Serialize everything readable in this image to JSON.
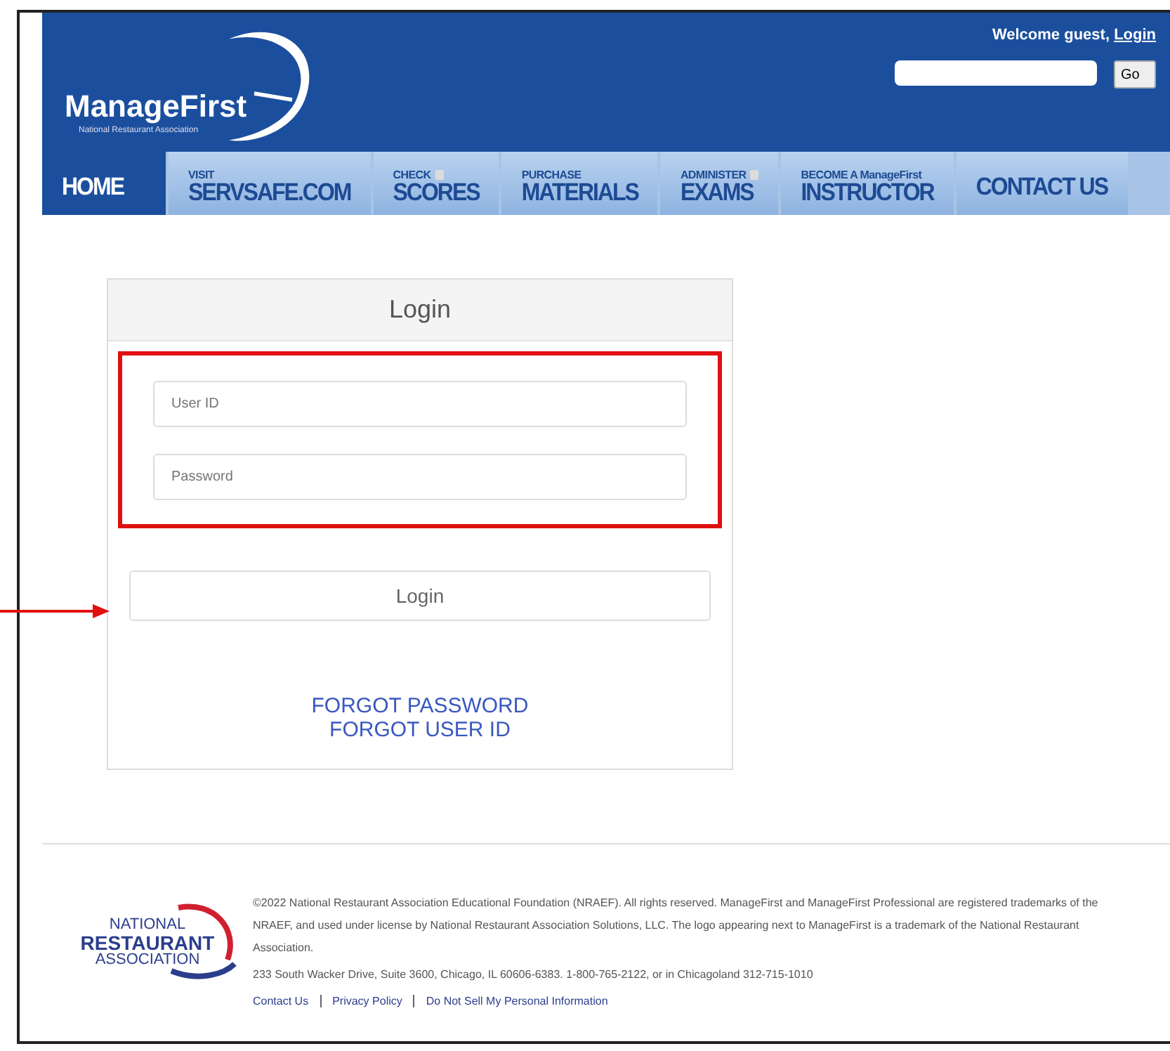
{
  "header": {
    "logo": {
      "name": "ManageFirst",
      "tagline": "National Restaurant Association"
    },
    "welcome": "Welcome guest,",
    "login_link": "Login",
    "search": {
      "button": "Go"
    }
  },
  "nav": [
    {
      "main": "HOME",
      "lock": false,
      "selected": true
    },
    {
      "top": "VISIT",
      "main": "SERVSAFE.COM",
      "lock": false,
      "selected": false
    },
    {
      "top": "CHECK",
      "main": "SCORES",
      "lock": true,
      "selected": false
    },
    {
      "top": "PURCHASE",
      "main": "MATERIALS",
      "lock": false,
      "selected": false
    },
    {
      "top": "ADMINISTER",
      "main": "EXAMS",
      "lock": true,
      "selected": false
    },
    {
      "top": "BECOME A ManageFirst",
      "main": "INSTRUCTOR",
      "lock": false,
      "selected": false
    },
    {
      "main": "CONTACT US",
      "lock": false,
      "selected": false
    }
  ],
  "login": {
    "title": "Login",
    "fields": [
      {
        "placeholder": "User ID"
      },
      {
        "placeholder": "Password"
      }
    ],
    "button": "Login",
    "links": [
      "FORGOT PASSWORD",
      "FORGOT USER ID"
    ]
  },
  "footer": {
    "logo": {
      "top": "NATIONAL",
      "middle": "RESTAURANT",
      "bottom": "ASSOCIATION"
    },
    "legal": "©2022 National Restaurant Association Educational Foundation (NRAEF). All rights reserved. ManageFirst and ManageFirst Professional are registered trademarks of the NRAEF, and used under license by National Restaurant Association Solutions, LLC. The logo appearing next to ManageFirst is a trademark of the National Restaurant Association.",
    "address": "233 South Wacker Drive, Suite 3600, Chicago, IL 60606-6383. 1-800-765-2122, or in Chicagoland 312-715-1010",
    "links": [
      "Contact Us",
      "Privacy Policy",
      "Do Not Sell My Personal Information"
    ]
  }
}
